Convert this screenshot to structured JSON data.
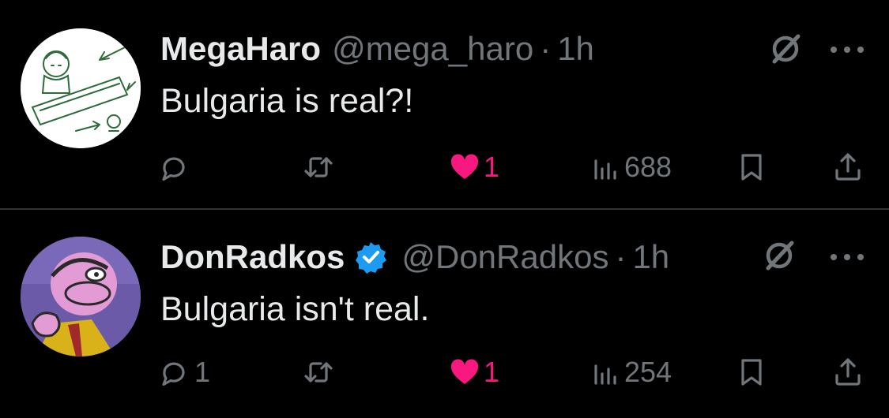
{
  "tweets": [
    {
      "display_name": "MegaHaro",
      "handle": "@mega_haro",
      "separator": "·",
      "time": "1h",
      "verified": false,
      "text": "Bulgaria is real?!",
      "replies": "",
      "retweets": "",
      "likes": "1",
      "liked": true,
      "views": "688"
    },
    {
      "display_name": "DonRadkos",
      "handle": "@DonRadkos",
      "separator": "·",
      "time": "1h",
      "verified": true,
      "text": "Bulgaria isn't real.",
      "replies": "1",
      "retweets": "",
      "likes": "1",
      "liked": true,
      "views": "254"
    }
  ],
  "colors": {
    "background": "#000000",
    "text_primary": "#e7e9ea",
    "text_secondary": "#71767b",
    "like_pink": "#f91880",
    "verified_blue": "#1d9bf0",
    "divider": "#2f3336"
  },
  "icons": [
    "grok-icon",
    "more-icon",
    "reply-icon",
    "retweet-icon",
    "heart-icon",
    "views-icon",
    "bookmark-icon",
    "share-icon",
    "verified-badge-icon"
  ]
}
